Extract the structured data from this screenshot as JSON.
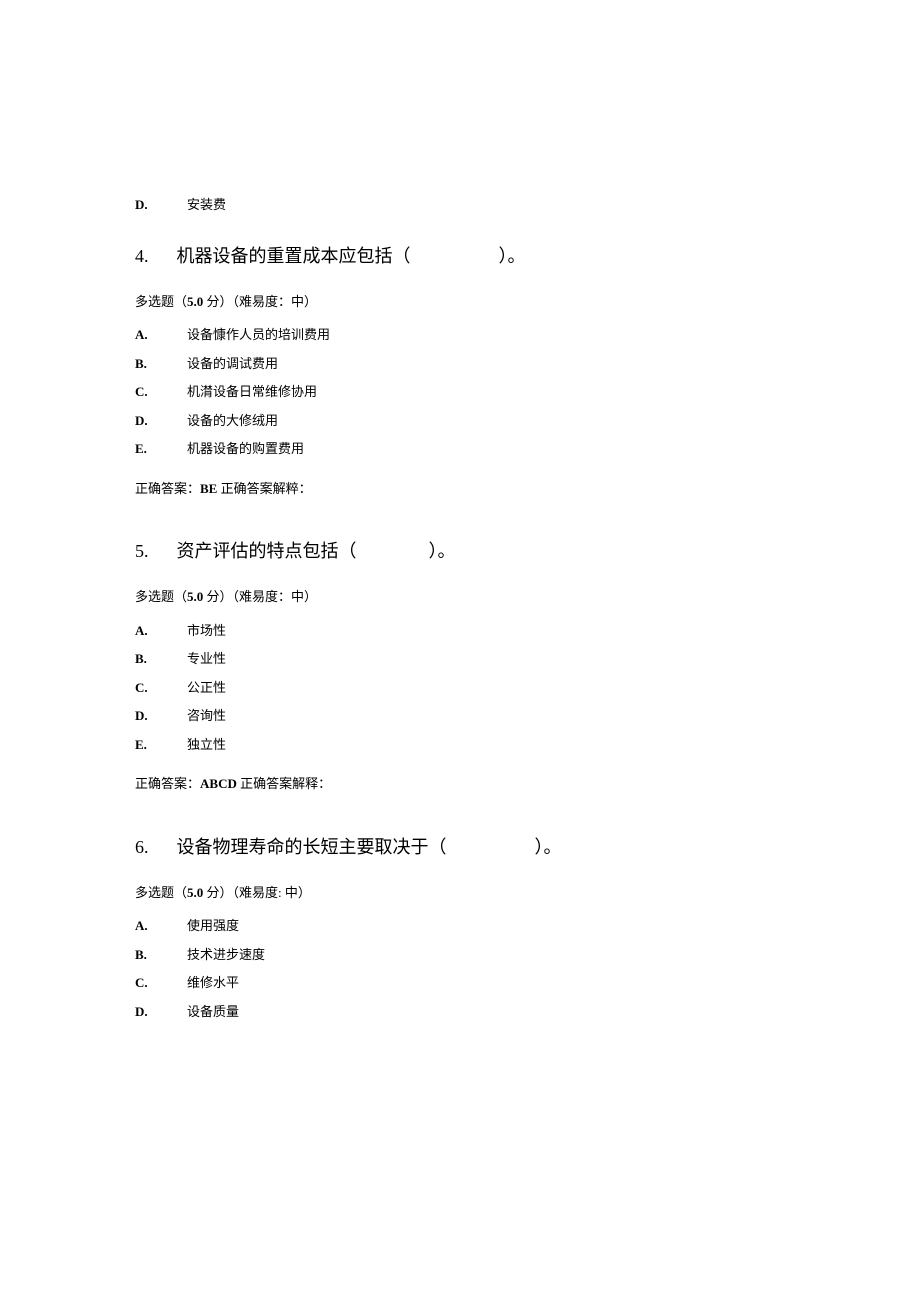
{
  "partial_option": {
    "letter": "D.",
    "text": "安装费"
  },
  "questions": [
    {
      "number": "4.",
      "stem_prefix": "机器设备的重置成本应包括（",
      "stem_suffix": "）。",
      "meta_prefix": "多选题（",
      "points": "5.0",
      "meta_mid": " 分）（难易度：中）",
      "options": [
        {
          "letter": "A.",
          "text": "设备慷作人员的培训费用"
        },
        {
          "letter": "B.",
          "text": "设备的调试费用"
        },
        {
          "letter": "C.",
          "text": "机潸设备日常维修协用"
        },
        {
          "letter": "D.",
          "text": "设备的大修绒用"
        },
        {
          "letter": "E.",
          "text": "机器设备的购置费用"
        }
      ],
      "answer_label": "正确答案：",
      "answer": "BE",
      "answer_explain": " 正确答案解粹："
    },
    {
      "number": "5.",
      "stem_prefix": "资产评估的特点包括（",
      "stem_suffix": "）。",
      "meta_prefix": "多选题（",
      "points": "5.0",
      "meta_mid": " 分）（难易度：中）",
      "options": [
        {
          "letter": "A.",
          "text": "市场性"
        },
        {
          "letter": "B.",
          "text": "专业性"
        },
        {
          "letter": "C.",
          "text": "公正性"
        },
        {
          "letter": "D.",
          "text": "咨询性"
        },
        {
          "letter": "E.",
          "text": "独立性"
        }
      ],
      "answer_label": "正确答案：",
      "answer": "ABCD",
      "answer_explain": " 正确答案解释："
    },
    {
      "number": "6.",
      "stem_prefix": "设备物理寿命的长短主要取决于（",
      "stem_suffix": "）。",
      "meta_prefix": "多选题（",
      "points": "5.0",
      "meta_mid": " 分）（难易度: 中）",
      "options": [
        {
          "letter": "A.",
          "text": "使用强度"
        },
        {
          "letter": "B.",
          "text": " 技术进步速度"
        },
        {
          "letter": "C.",
          "text": "维修水平"
        },
        {
          "letter": "D.",
          "text": "设备质量"
        }
      ]
    }
  ]
}
